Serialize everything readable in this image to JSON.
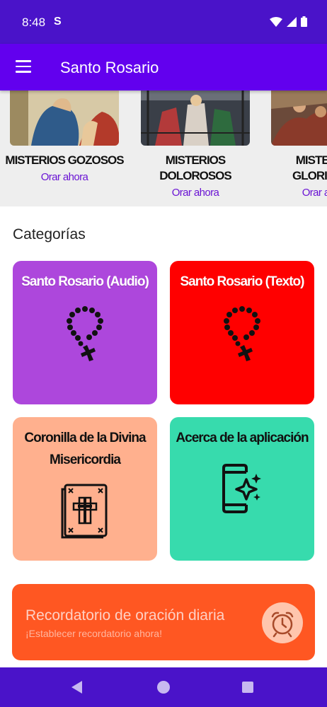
{
  "status_bar": {
    "time": "8:48",
    "s_icon": "S"
  },
  "app_bar": {
    "title": "Santo Rosario"
  },
  "mysteries": [
    {
      "title": "MISTERIOS GOZOSOS",
      "action": "Orar ahora"
    },
    {
      "title": "MISTERIOS DOLOROSOS",
      "action": "Orar ahora"
    },
    {
      "title": "MISTERIOS GLORIOSOS",
      "action": "Orar ahora"
    }
  ],
  "categories_title": "Categorías",
  "categories": [
    {
      "label": "Santo Rosario (Audio)",
      "color": "#ad47dc",
      "icon": "rosary-icon"
    },
    {
      "label": "Santo Rosario (Texto)",
      "color": "#ff0000",
      "icon": "rosary-icon"
    },
    {
      "label": "Coronilla de la Divina Misericordia",
      "color": "#ffb08e",
      "icon": "bible-icon"
    },
    {
      "label": "Acerca de la aplicación",
      "color": "#37dbad",
      "icon": "phone-sparkle-icon"
    }
  ],
  "reminder": {
    "title": "Recordatorio de oración diaria",
    "subtitle": "¡Establecer recordatorio ahora!",
    "icon": "alarm-clock-icon"
  },
  "colors": {
    "status_bar": "#4a13c9",
    "app_bar": "#6200ee",
    "accent_link": "#6a14d4",
    "reminder": "#ff5722"
  }
}
